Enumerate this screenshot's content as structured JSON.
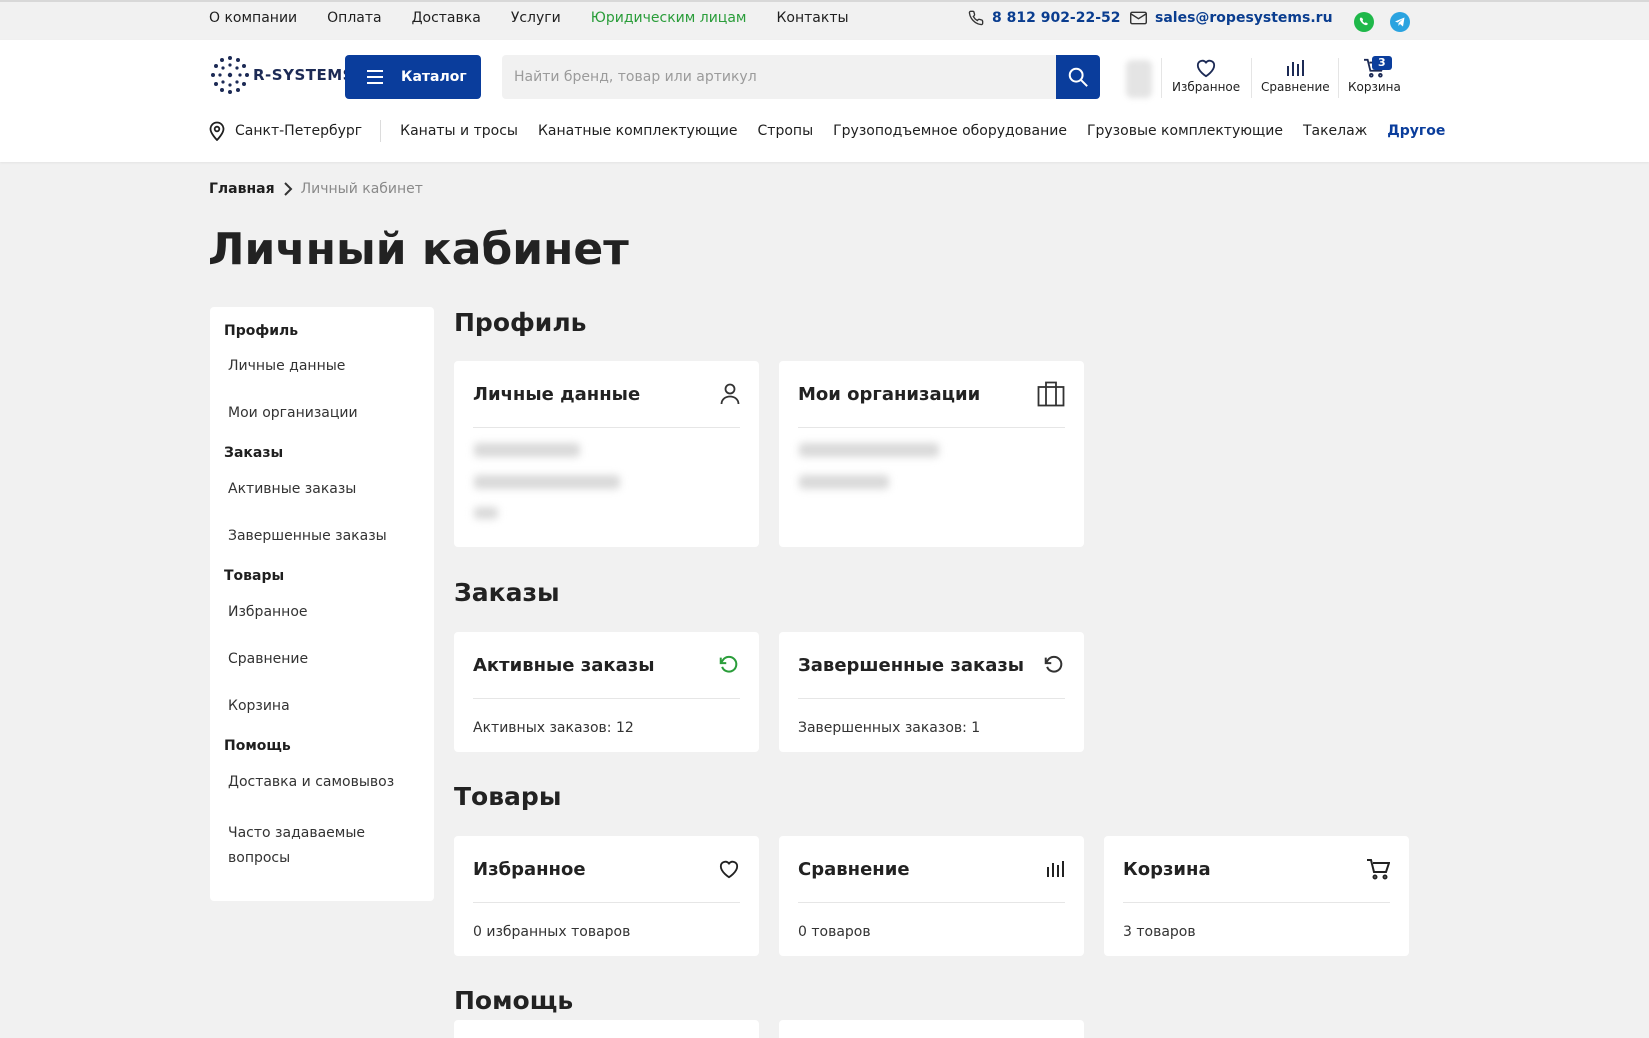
{
  "topbar": {
    "links": [
      {
        "label": "О компании",
        "highlight": false
      },
      {
        "label": "Оплата",
        "highlight": false
      },
      {
        "label": "Доставка",
        "highlight": false
      },
      {
        "label": "Услуги",
        "highlight": false
      },
      {
        "label": "Юридическим лицам",
        "highlight": true
      },
      {
        "label": "Контакты",
        "highlight": false
      }
    ],
    "phone": "8 812 902-22-52",
    "email": "sales@ropesystems.ru"
  },
  "header": {
    "logo_text": "R-SYSTEMS",
    "catalog_label": "Каталог",
    "search_placeholder": "Найти бренд, товар или артикул",
    "favorites_label": "Избранное",
    "compare_label": "Сравнение",
    "cart_label": "Корзина",
    "cart_count": "3"
  },
  "nav": {
    "city": "Санкт-Петербург",
    "items": [
      "Канаты и тросы",
      "Канатные комплектующие",
      "Стропы",
      "Грузоподъемное оборудование",
      "Грузовые комплектующие",
      "Такелаж"
    ],
    "more": "Другое"
  },
  "breadcrumb": {
    "home": "Главная",
    "current": "Личный кабинет"
  },
  "page_title": "Личный кабинет",
  "sidebar": {
    "profile": "Профиль",
    "personal_data": "Личные данные",
    "organizations": "Мои организации",
    "orders": "Заказы",
    "active_orders": "Активные заказы",
    "completed_orders": "Завершенные заказы",
    "goods": "Товары",
    "favorites": "Избранное",
    "compare": "Сравнение",
    "cart": "Корзина",
    "help": "Помощь",
    "delivery": "Доставка и самовывоз",
    "faq": "Часто задаваемые вопросы"
  },
  "sections": {
    "profile": {
      "title": "Профиль",
      "personal_card_title": "Личные данные",
      "org_card_title": "Мои организации"
    },
    "orders": {
      "title": "Заказы",
      "active_title": "Активные заказы",
      "active_text": "Активных заказов: 12",
      "completed_title": "Завершенные заказы",
      "completed_text": "Завершенных заказов: 1"
    },
    "goods": {
      "title": "Товары",
      "fav_title": "Избранное",
      "fav_text": "0 избранных товаров",
      "compare_title": "Сравнение",
      "compare_text": "0 товаров",
      "cart_title": "Корзина",
      "cart_text": "3 товаров"
    },
    "help": {
      "title": "Помощь"
    }
  },
  "colors": {
    "brand_blue": "#0a3d9c",
    "accent_green": "#2a9d3a",
    "background": "#f1f1f1"
  }
}
